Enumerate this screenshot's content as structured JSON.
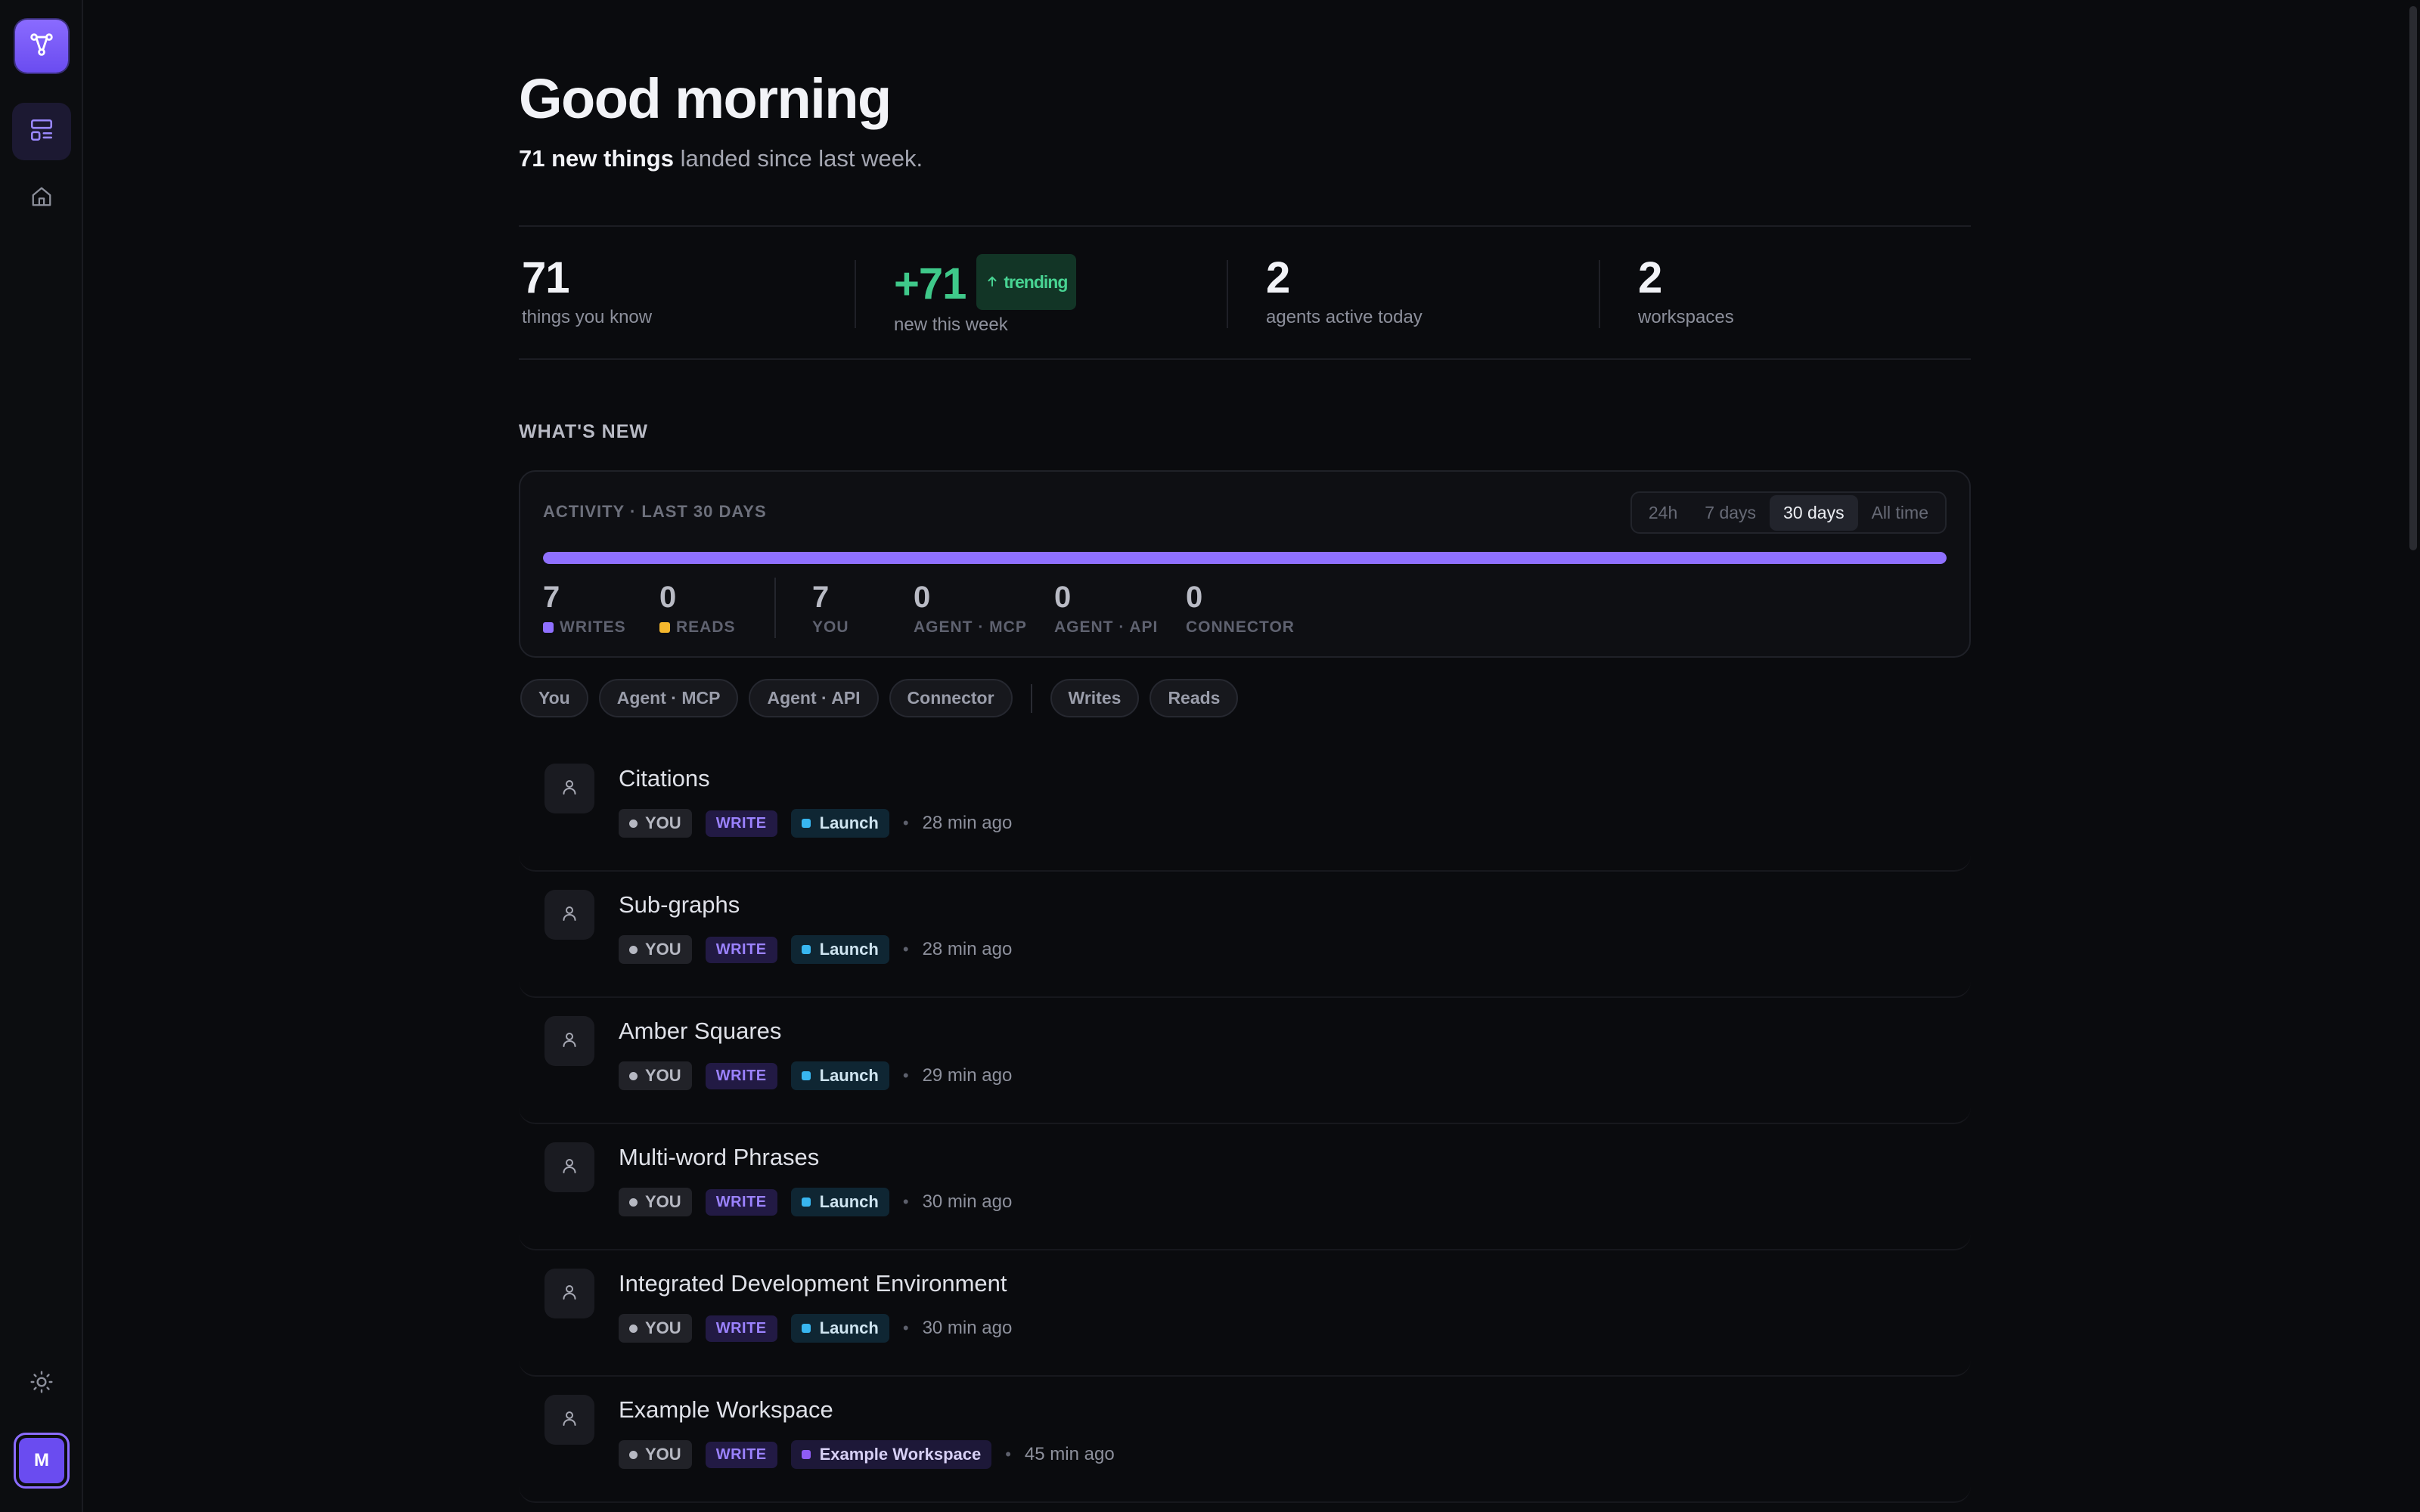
{
  "sidebar": {
    "user_initial": "M"
  },
  "header": {
    "greeting": "Good morning",
    "sub_bold": "71 new things",
    "sub_rest": "landed since last week."
  },
  "stats": [
    {
      "value": "71",
      "label": "things you know"
    },
    {
      "value": "+71",
      "label": "new this week",
      "badge": "trending"
    },
    {
      "value": "2",
      "label": "agents active today"
    },
    {
      "value": "2",
      "label": "workspaces"
    }
  ],
  "whats_new": {
    "title": "WHAT'S NEW",
    "activity_title": "ACTIVITY · LAST 30 DAYS",
    "ranges": [
      "24h",
      "7 days",
      "30 days",
      "All time"
    ],
    "selected_range": "30 days",
    "writes_fraction": 1.0,
    "counts": [
      {
        "value": "7",
        "label": "WRITES",
        "color": "#8f70ff"
      },
      {
        "value": "0",
        "label": "READS",
        "color": "#f5b72d"
      },
      {
        "value": "7",
        "label": "YOU"
      },
      {
        "value": "0",
        "label": "AGENT · MCP"
      },
      {
        "value": "0",
        "label": "AGENT · API"
      },
      {
        "value": "0",
        "label": "CONNECTOR"
      }
    ],
    "filters_source": [
      "You",
      "Agent · MCP",
      "Agent · API",
      "Connector"
    ],
    "filters_type": [
      "Writes",
      "Reads"
    ]
  },
  "feed": [
    {
      "title": "Citations",
      "actor": "YOU",
      "action": "WRITE",
      "workspace": "Launch",
      "ws_color": "#38b6f0",
      "time": "28 min ago"
    },
    {
      "title": "Sub-graphs",
      "actor": "YOU",
      "action": "WRITE",
      "workspace": "Launch",
      "ws_color": "#38b6f0",
      "time": "28 min ago"
    },
    {
      "title": "Amber Squares",
      "actor": "YOU",
      "action": "WRITE",
      "workspace": "Launch",
      "ws_color": "#38b6f0",
      "time": "29 min ago"
    },
    {
      "title": "Multi-word Phrases",
      "actor": "YOU",
      "action": "WRITE",
      "workspace": "Launch",
      "ws_color": "#38b6f0",
      "time": "30 min ago"
    },
    {
      "title": "Integrated Development Environment",
      "actor": "YOU",
      "action": "WRITE",
      "workspace": "Launch",
      "ws_color": "#38b6f0",
      "time": "30 min ago"
    },
    {
      "title": "Example Workspace",
      "actor": "YOU",
      "action": "WRITE",
      "workspace": "Example Workspace",
      "ws_color": "#8f5cf5",
      "time": "45 min ago"
    }
  ],
  "colors": {
    "accent": "#8f70ff",
    "trend_green": "#3fc98a",
    "background": "#0a0b0e"
  }
}
